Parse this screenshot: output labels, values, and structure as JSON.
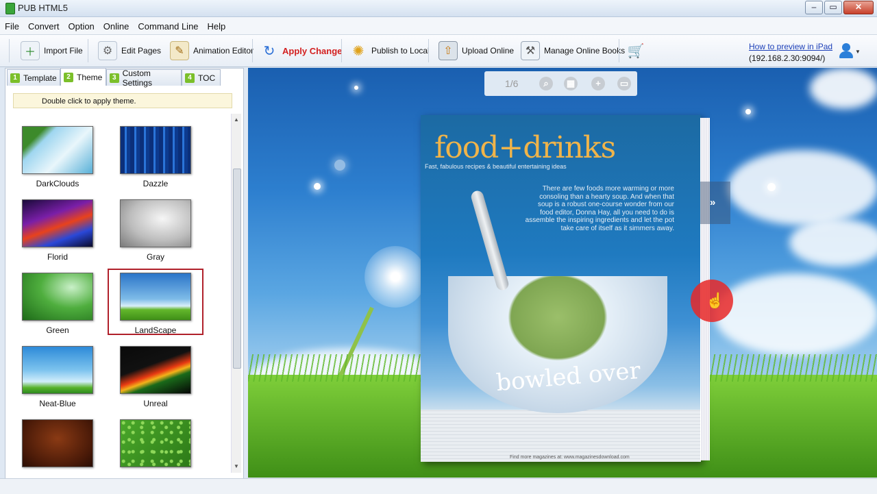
{
  "window": {
    "title": "PUB HTML5"
  },
  "menu": [
    "File",
    "Convert",
    "Option",
    "Online",
    "Command Line",
    "Help"
  ],
  "toolbar": {
    "import": "Import File",
    "edit": "Edit Pages",
    "animation": "Animation Editor",
    "apply": "Apply Change",
    "publish": "Publish to Local",
    "upload": "Upload Online",
    "manage": "Manage Online Books",
    "preview_link": "How to preview in iPad",
    "preview_ip": "(192.168.2.30:9094/)"
  },
  "tabs": [
    {
      "num": "1",
      "label": "Template"
    },
    {
      "num": "2",
      "label": "Theme"
    },
    {
      "num": "3",
      "label": "Custom Settings"
    },
    {
      "num": "4",
      "label": "TOC"
    }
  ],
  "hint": "Double click to apply theme.",
  "themes": [
    {
      "name": "DarkClouds"
    },
    {
      "name": "Dazzle"
    },
    {
      "name": "Florid"
    },
    {
      "name": "Gray"
    },
    {
      "name": "Green"
    },
    {
      "name": "LandScape",
      "selected": true
    },
    {
      "name": "Neat-Blue"
    },
    {
      "name": "Unreal"
    },
    {
      "name": ""
    },
    {
      "name": ""
    }
  ],
  "viewer": {
    "page_indicator": "1/6"
  },
  "book": {
    "masthead": "food+drinks",
    "subtitle": "Fast, fabulous recipes & beautiful entertaining ideas",
    "intro": "There are few foods more warming or more consoling than a hearty soup. And when that soup is a robust one-course wonder from our food editor, Donna Hay, all you need to do is assemble the inspiring ingredients and let the pot take care of itself as it simmers away.",
    "headline": "bowled over",
    "footer": "Find more magazines at: www.magazinesdownload.com"
  },
  "colors": {
    "accent_red": "#d31f1f",
    "tab_green": "#7bbf2a",
    "link_blue": "#1c3fb8"
  }
}
